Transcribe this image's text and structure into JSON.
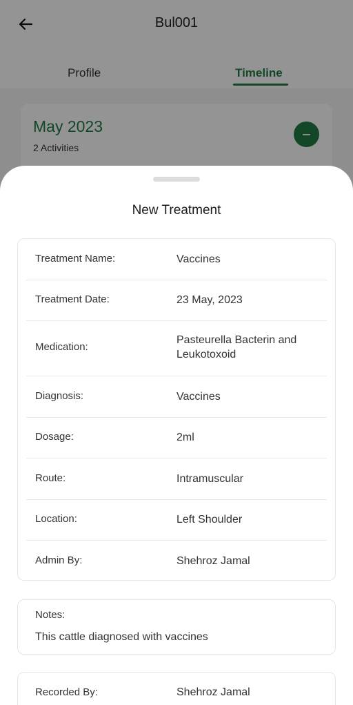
{
  "header": {
    "title": "Bul001"
  },
  "tabs": [
    {
      "label": "Profile",
      "active": false
    },
    {
      "label": "Timeline",
      "active": true
    }
  ],
  "timeline": {
    "month": "May 2023",
    "activity_count": "2 Activities"
  },
  "sheet": {
    "title": "New Treatment",
    "details": [
      {
        "label": "Treatment Name:",
        "value": "Vaccines"
      },
      {
        "label": "Treatment Date:",
        "value": "23 May, 2023"
      },
      {
        "label": "Medication:",
        "value": "Pasteurella Bacterin and Leukotoxoid"
      },
      {
        "label": "Diagnosis:",
        "value": "Vaccines"
      },
      {
        "label": "Dosage:",
        "value": "2ml"
      },
      {
        "label": "Route:",
        "value": "Intramuscular"
      },
      {
        "label": "Location:",
        "value": "Left Shoulder"
      },
      {
        "label": "Admin By:",
        "value": "Shehroz Jamal"
      }
    ],
    "notes": {
      "label": "Notes:",
      "text": "This cattle diagnosed with vaccines"
    },
    "recorded": {
      "label": "Recorded By:",
      "value": "Shehroz Jamal"
    }
  },
  "colors": {
    "accent": "#1f7a45",
    "scrim": "rgba(0,0,0,0.42)"
  }
}
